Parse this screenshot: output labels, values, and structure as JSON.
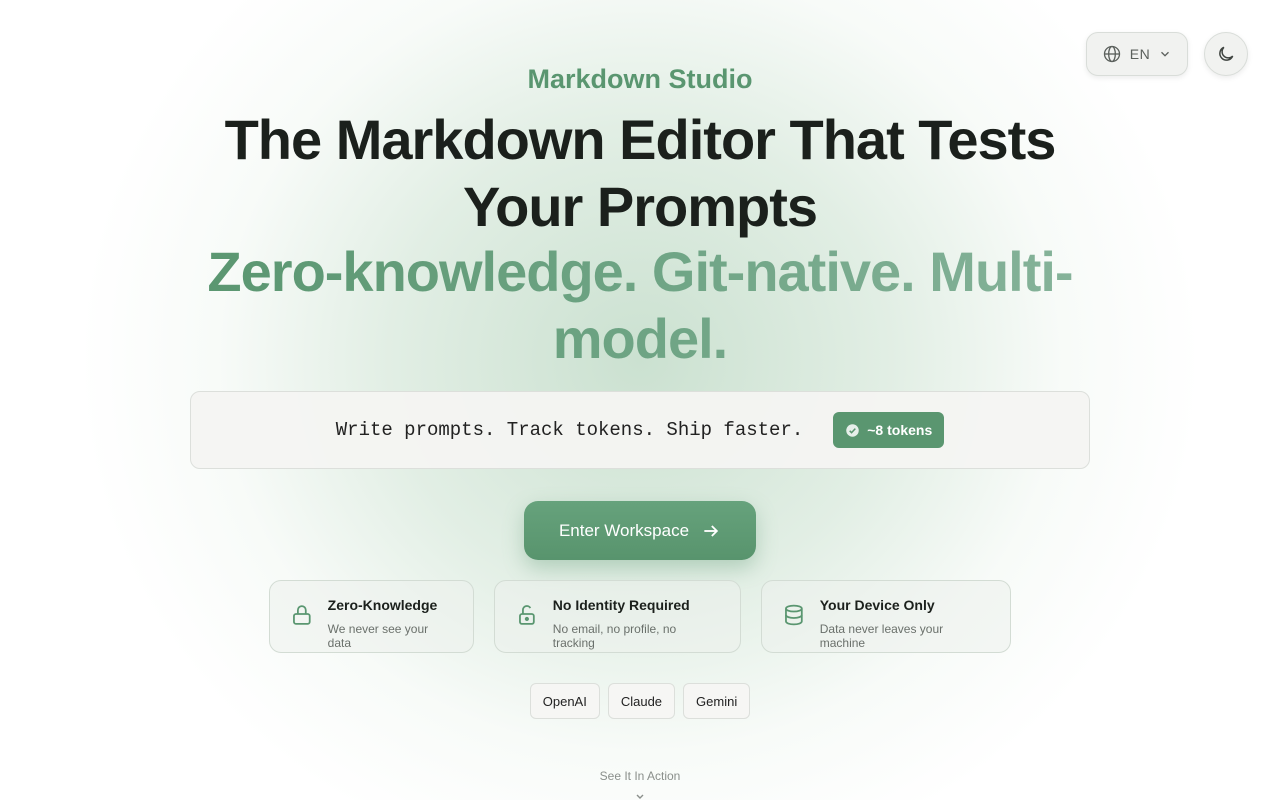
{
  "top_controls": {
    "language": "EN",
    "language_icon": "globe-icon",
    "chevron_icon": "chevron-down-icon",
    "theme_icon": "moon-icon"
  },
  "hero": {
    "brand": "Markdown Studio",
    "headline": "The Markdown Editor That Tests Your Prompts",
    "subline": "Zero-knowledge. Git-native. Multi-model."
  },
  "prompt_demo": {
    "text": "Write prompts. Track tokens. Ship faster.",
    "token_badge": "~8 tokens"
  },
  "cta": {
    "label": "Enter Workspace",
    "icon": "arrow-right-icon"
  },
  "features": [
    {
      "icon": "lock-icon",
      "title": "Zero-Knowledge",
      "desc": "We never see your data"
    },
    {
      "icon": "unlock-icon",
      "title": "No Identity Required",
      "desc": "No email, no profile, no tracking"
    },
    {
      "icon": "database-icon",
      "title": "Your Device Only",
      "desc": "Data never leaves your machine"
    }
  ],
  "models": [
    "OpenAI",
    "Claude",
    "Gemini"
  ],
  "footer": {
    "see_in_action": "See It In Action"
  },
  "colors": {
    "accent": "#5a9670",
    "headline": "#1b201c"
  }
}
